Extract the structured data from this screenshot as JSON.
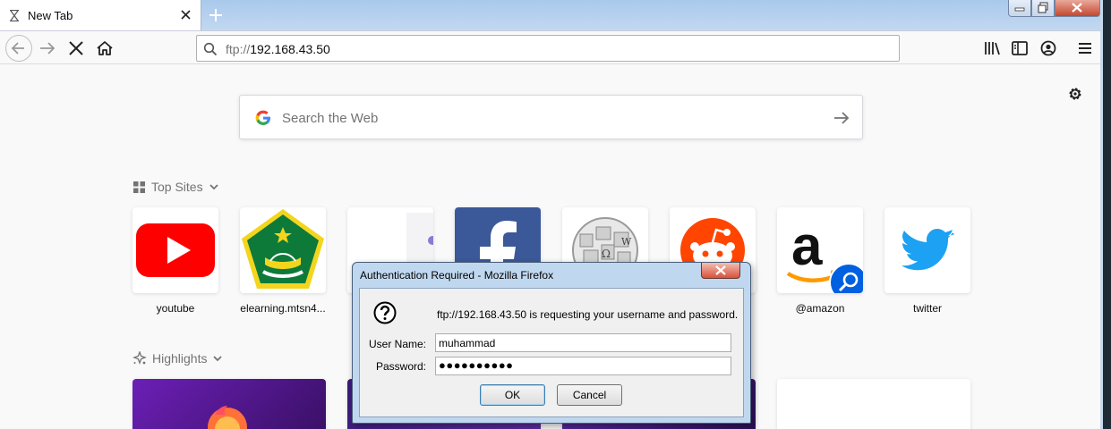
{
  "browser": {
    "tab_title": "New Tab",
    "url_protocol": "ftp://",
    "url_host": "192.168.43.50"
  },
  "newtab": {
    "search_placeholder": "Search the Web",
    "top_sites_heading": "Top Sites",
    "highlights_heading": "Highlights",
    "top_sites": [
      {
        "label": "youtube",
        "icon": "youtube-logo"
      },
      {
        "label": "elearning.mtsn4...",
        "icon": "kemenag-emblem"
      },
      {
        "label": "",
        "icon": "partial-site-logo"
      },
      {
        "label": "",
        "icon": "facebook-logo"
      },
      {
        "label": "",
        "icon": "wikipedia-globe"
      },
      {
        "label": "",
        "icon": "reddit-logo"
      },
      {
        "label": "@amazon",
        "icon": "amazon-logo"
      },
      {
        "label": "twitter",
        "icon": "twitter-bird"
      }
    ]
  },
  "dialog": {
    "title": "Authentication Required - Mozilla Firefox",
    "message": "ftp://192.168.43.50 is requesting your username and password.",
    "user_label": "User Name:",
    "user_value": "muhammad",
    "password_label": "Password:",
    "password_value": "●●●●●●●●●●",
    "ok_label": "OK",
    "cancel_label": "Cancel"
  },
  "colors": {
    "youtube_red": "#ff0000",
    "facebook_blue": "#3b5998",
    "reddit_orange": "#ff4500",
    "twitter_blue": "#1da1f2",
    "amazon_orange": "#ff9900"
  }
}
